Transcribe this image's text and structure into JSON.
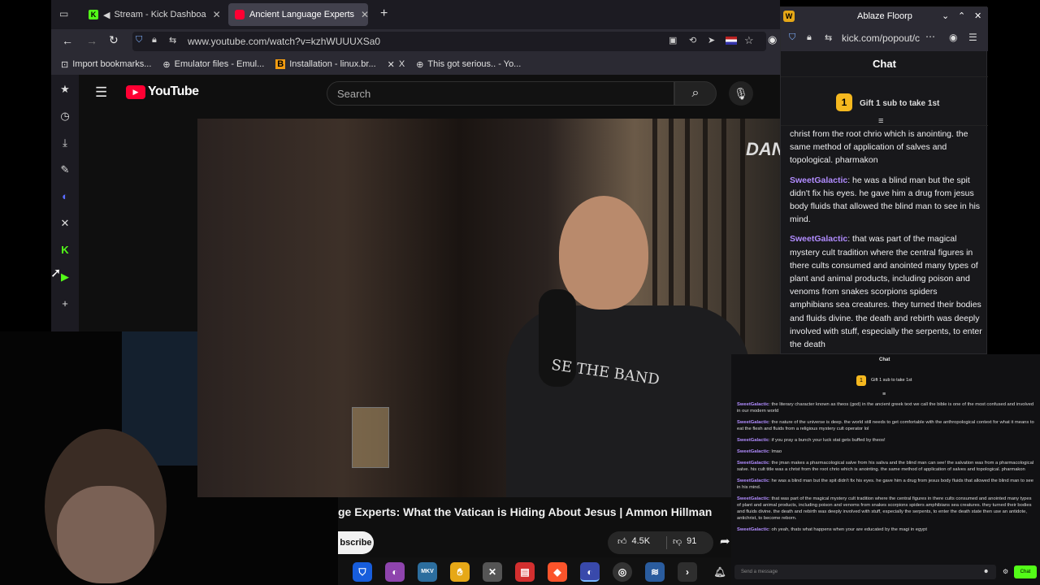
{
  "tabs": [
    {
      "label": "Stream - Kick Dashboa",
      "favicon": "kick-icon",
      "color": "#53fc18"
    },
    {
      "label": "Ancient Language Experts",
      "favicon": "youtube-icon",
      "color": "#ff0033"
    }
  ],
  "nav": {
    "url": "www.youtube.com/watch?v=kzhWUUUXSa0"
  },
  "bookmarks": [
    {
      "label": "Import bookmarks...",
      "icon": "import-icon"
    },
    {
      "label": "Emulator files - Emul...",
      "icon": "globe-icon"
    },
    {
      "label": "Installation - linux.br...",
      "icon": "bookmark-b-icon"
    },
    {
      "label": "X",
      "icon": "x-icon"
    },
    {
      "label": "This got serious.. - Yo...",
      "icon": "globe-icon"
    }
  ],
  "youtube": {
    "logo": "YouTube",
    "search_placeholder": "Search",
    "video_title": "ge Experts: What the Vatican is Hiding About Jesus | Ammon Hillman",
    "subscribe": "bscribe",
    "likes": "4.5K",
    "dislikes": "91",
    "watermark": "DAN",
    "shirt_text": "SE THE BAND"
  },
  "popout": {
    "window_title": "Ablaze Floorp",
    "url": "kick.com/popout/c",
    "header": "Chat",
    "gift_text": "Gift 1 sub to take 1st",
    "gift_badge": "1",
    "messages": [
      {
        "user": "",
        "text": "christ from the root chrio which is anointing. the same method of application of salves and topological. pharmakon"
      },
      {
        "user": "SweetGalactic",
        "text": "he was a blind man but the spit didn't fix his eyes. he gave him a drug from jesus body fluids that allowed the blind man to see in his mind."
      },
      {
        "user": "SweetGalactic",
        "text": "that was part of the magical mystery cult tradition where the central figures in there cults consumed and anointed many types of plant and animal products, including poison and venoms from snakes scorpions spiders amphibians sea creatures. they turned their bodies and fluids divine. the death and rebirth was deeply involved with stuff, especially the serpents, to enter the death"
      }
    ]
  },
  "overlay_chat": {
    "header": "Chat",
    "gift_text": "Gift 1 sub to take 1st",
    "gift_badge": "1",
    "input_placeholder": "Send a message",
    "send_label": "Chat",
    "messages": [
      {
        "user": "SweetGalactic",
        "text": "the literary character known as theos (god) in the ancient greek text we call the bible is one of the most confused and involved in our modern world"
      },
      {
        "user": "SweetGalactic",
        "text": "the nature of the universe is deep. the world still needs to get comfortable with the anthropological context for what it means to eat the flesh and fluids from a religious mystery cult operator lol"
      },
      {
        "user": "SweetGalactic",
        "text": "if you pray a bunch your luck stat gets buffed by theos!"
      },
      {
        "user": "SweetGalactic",
        "text": "lmao"
      },
      {
        "user": "SweetGalactic",
        "text": "the jman makes a pharmacological salve from his saliva and the blind man can see! the salvation was from a pharmacological salve. his cult title was a christ from the root chrio which is anointing. the same method of application of salves and topological. pharmakon"
      },
      {
        "user": "SweetGalactic",
        "text": "he was a blind man but the spit didn't fix his eyes. he gave him a drug from jesus body fluids that allowed the blind man to see in his mind."
      },
      {
        "user": "SweetGalactic",
        "text": "that was part of the magical mystery cult tradition where the central figures in there cults consumed and anointed many types of plant and animal products, including poison and venoms from snakes scorpions spiders amphibians sea creatures. they turned their bodies and fluids divine. the death and rebirth was deeply involved with stuff, especially the serpents, to enter the death state then use an antidote, antichrist, to become reborn."
      },
      {
        "user": "SweetGalactic",
        "text": "oh yeah, thats what happens when your are educated by the magi in egypt"
      }
    ]
  },
  "colors": {
    "kick_green": "#53fc18",
    "chat_user": "#b18cff",
    "youtube_red": "#ff0033"
  }
}
